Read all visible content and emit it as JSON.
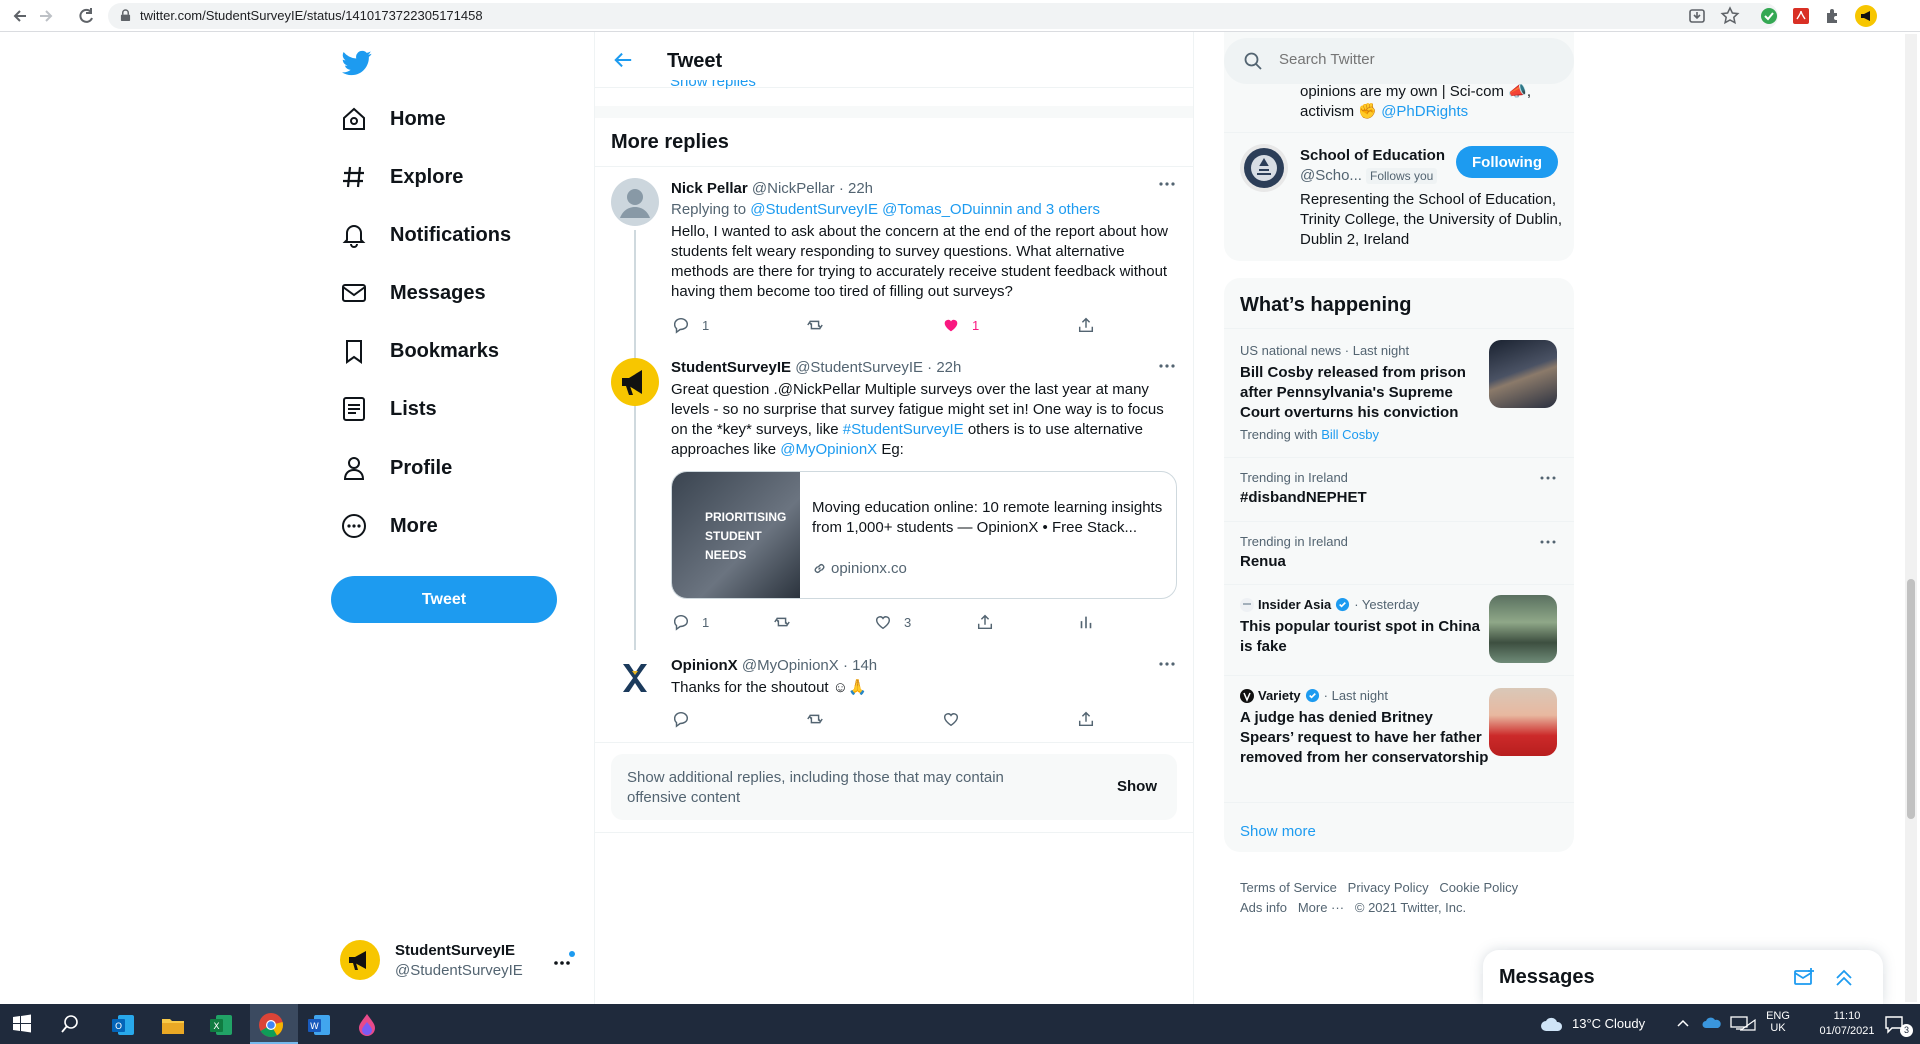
{
  "browser": {
    "url": "twitter.com/StudentSurveyIE/status/1410173722305171458"
  },
  "nav": {
    "items": [
      {
        "label": "Home",
        "icon": "home-icon"
      },
      {
        "label": "Explore",
        "icon": "hashtag-icon"
      },
      {
        "label": "Notifications",
        "icon": "bell-icon"
      },
      {
        "label": "Messages",
        "icon": "envelope-icon"
      },
      {
        "label": "Bookmarks",
        "icon": "bookmark-icon"
      },
      {
        "label": "Lists",
        "icon": "list-icon"
      },
      {
        "label": "Profile",
        "icon": "person-icon"
      },
      {
        "label": "More",
        "icon": "more-circle-icon"
      }
    ],
    "tweet_button": "Tweet",
    "account": {
      "name": "StudentSurveyIE",
      "handle": "@StudentSurveyIE"
    }
  },
  "header": {
    "title": "Tweet",
    "prev_link": "Show replies"
  },
  "more_replies": "More replies",
  "replies": [
    {
      "name": "Nick Pellar",
      "handle": "@NickPellar",
      "time": "· 22h",
      "replying_prefix": "Replying to",
      "replying_to": "@StudentSurveyIE @Tomas_ODuinnin  and 3 others",
      "text": "Hello, I wanted to ask about the concern at the end of the report about how students felt weary responding to survey questions. What alternative methods are there for trying to accurately receive student feedback without having them become too tired of filling out surveys?",
      "replies": "1",
      "likes": "1"
    },
    {
      "name": "StudentSurveyIE",
      "handle": "@StudentSurveyIE",
      "time": "· 22h",
      "text_part1": "Great question .@NickPellar Multiple surveys over the last year at many levels - so no surprise that survey fatigue might set in! One way is to focus on the *key* surveys, like ",
      "hashtag": "#StudentSurveyIE",
      "text_part2": " others is to use alternative approaches like ",
      "mention": "@MyOpinionX",
      "text_part3": " Eg:",
      "card": {
        "image_text": "PRIORITISING STUDENT NEEDS",
        "title": "Moving education online: 10 remote learning insights from 1,000+ students — OpinionX • Free Stack...",
        "domain": "opinionx.co"
      },
      "replies": "1",
      "likes": "3"
    },
    {
      "name": "OpinionX",
      "handle": "@MyOpinionX",
      "time": "· 14h",
      "text": "Thanks for the shoutout ☺🙏"
    }
  ],
  "additional": {
    "text": "Show additional replies, including those that may contain offensive content",
    "button": "Show"
  },
  "right": {
    "search_placeholder": "Search Twitter",
    "follow_partial_bio": "opinions are my own | Sci-com 📣,",
    "follow_partial_bio2": "activism ✊ ",
    "follow_partial_link": "@PhDRights",
    "follow": {
      "name": "School of Education",
      "handle": "@Scho...",
      "follows_you": "Follows you",
      "button": "Following",
      "bio": "Representing the School of Education, Trinity College, the University of Dublin, Dublin 2, Ireland"
    },
    "happening": {
      "title": "What’s happening",
      "trends": [
        {
          "meta": "US national news · Last night",
          "title": "Bill Cosby released from prison after Pennsylvania's Supreme Court overturns his conviction",
          "trending_with_label": "Trending with",
          "trending_with": "Bill Cosby"
        },
        {
          "meta": "Trending in Ireland",
          "title": "#disbandNEPHET"
        },
        {
          "meta": "Trending in Ireland",
          "title": "Renua"
        },
        {
          "source": "Insider Asia",
          "meta": "· Yesterday",
          "title": "This popular tourist spot in China is fake"
        },
        {
          "source": "Variety",
          "meta": "· Last night",
          "title": "A judge has denied Britney Spears’ request to have her father removed from her conservatorship"
        }
      ],
      "show_more": "Show more"
    },
    "footer": {
      "links": [
        "Terms of Service",
        "Privacy Policy",
        "Cookie Policy",
        "Ads info",
        "More ···"
      ],
      "copyright": "© 2021 Twitter, Inc."
    },
    "messages_title": "Messages"
  },
  "taskbar": {
    "weather": "13°C  Cloudy",
    "lang1": "ENG",
    "lang2": "UK",
    "time": "11:10",
    "date": "01/07/2021",
    "notif_count": "3"
  }
}
